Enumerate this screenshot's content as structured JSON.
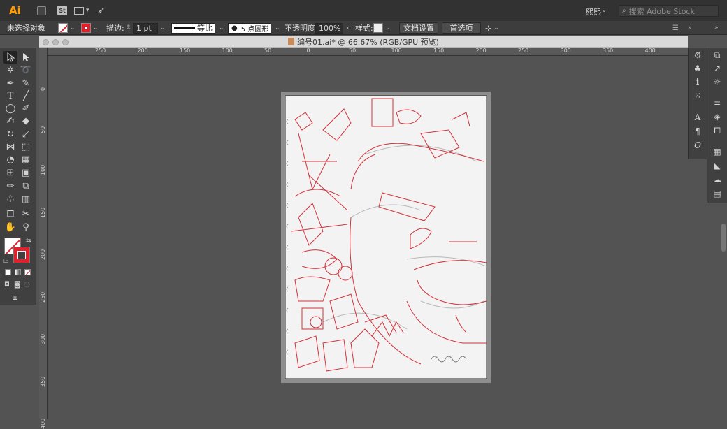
{
  "app": {
    "logo": "Ai",
    "workspace": "熙熙",
    "stock_search_placeholder": "搜索 Adobe Stock",
    "bridge_label": "St"
  },
  "control_bar": {
    "selection_label": "未选择对象",
    "stroke_label": "描边:",
    "stroke_weight": "1 pt",
    "stroke_profile": "等比",
    "brush": "5 点圆形",
    "opacity_label": "不透明度:",
    "opacity_value": "100%",
    "style_label": "样式:",
    "doc_setup_button": "文档设置",
    "prefs_button": "首选项"
  },
  "document": {
    "tab_title": "编号01.ai* @ 66.67% (RGB/GPU 预览)"
  },
  "rulers": {
    "h_ticks": [
      "250",
      "200",
      "150",
      "100",
      "50",
      "0",
      "50",
      "100",
      "150",
      "200",
      "250",
      "300",
      "350",
      "400"
    ],
    "v_ticks": [
      "0",
      "50",
      "100",
      "150",
      "200",
      "250",
      "300",
      "350",
      "400"
    ]
  },
  "colors": {
    "accent": "#e0202c",
    "logo": "#ff9a00",
    "app_bg": "#535353",
    "panel_bg": "#404040"
  },
  "tools": [
    "selection-tool",
    "direct-selection-tool",
    "magic-wand-tool",
    "lasso-tool",
    "pen-tool",
    "curvature-tool",
    "type-tool",
    "line-tool",
    "ellipse-tool",
    "paintbrush-tool",
    "shaper-tool",
    "eraser-tool",
    "rotate-tool",
    "scale-tool",
    "width-tool",
    "free-transform-tool",
    "shape-builder-tool",
    "perspective-grid-tool",
    "mesh-tool",
    "gradient-tool",
    "eyedropper-tool",
    "blend-tool",
    "symbol-sprayer-tool",
    "column-graph-tool",
    "artboard-tool",
    "slice-tool",
    "hand-tool",
    "zoom-tool"
  ]
}
